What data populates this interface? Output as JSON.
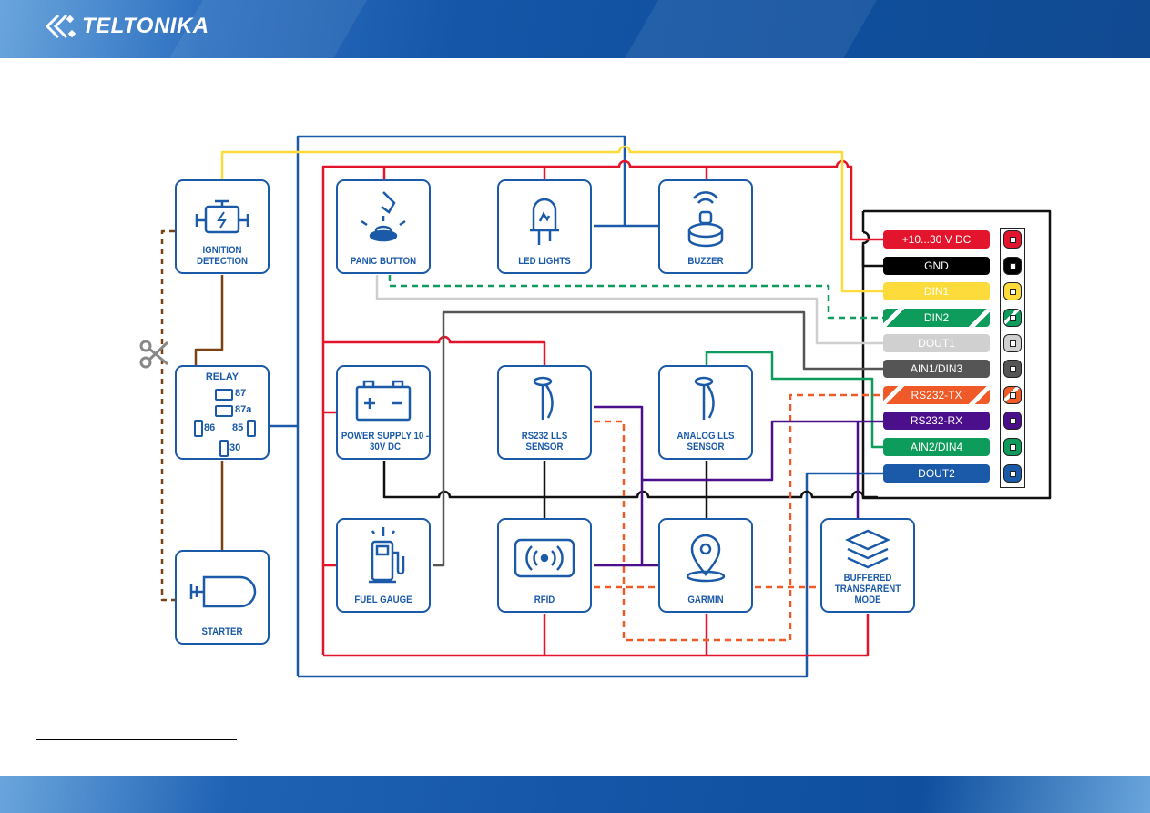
{
  "header": {
    "logo_text": "TELTONIKA"
  },
  "devices": {
    "ignition": "IGNITION DETECTION",
    "relay": "RELAY",
    "starter": "STARTER",
    "panic": "PANIC BUTTON",
    "led": "LED LIGHTS",
    "buzzer": "BUZZER",
    "power": "POWER SUPPLY 10 - 30V DC",
    "rs232_lls": "RS232 LLS SENSOR",
    "analog_lls": "ANALOG LLS SENSOR",
    "fuel": "FUEL GAUGE",
    "rfid": "RFID",
    "garmin": "GARMIN",
    "buffered": "BUFFERED TRANSPARENT MODE"
  },
  "relay_pins": {
    "p87": "87",
    "p87a": "87a",
    "p86": "86",
    "p85": "85",
    "p30": "30"
  },
  "connector": [
    {
      "label": "+10...30 V DC",
      "color": "#e3152c"
    },
    {
      "label": "GND",
      "color": "#000000"
    },
    {
      "label": "DIN1",
      "color": "#fddb3a"
    },
    {
      "label": "DIN2",
      "color": "#0d9c5b",
      "striped": true
    },
    {
      "label": "DOUT1",
      "color": "#d0d0d0"
    },
    {
      "label": "AIN1/DIN3",
      "color": "#555555"
    },
    {
      "label": "RS232-TX",
      "color": "#f05a28",
      "striped": true
    },
    {
      "label": "RS232-RX",
      "color": "#4b0f8c"
    },
    {
      "label": "AIN2/DIN4",
      "color": "#0d9c5b"
    },
    {
      "label": "DOUT2",
      "color": "#1a5aa8"
    }
  ]
}
